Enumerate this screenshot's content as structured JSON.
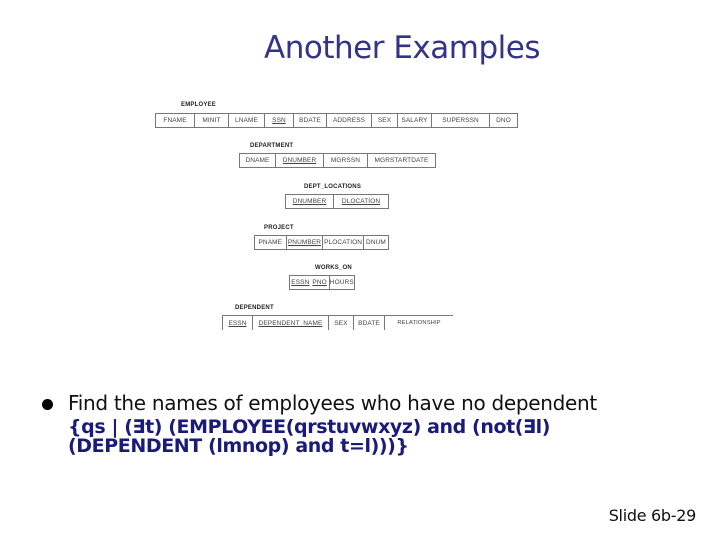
{
  "slide": {
    "title": "Another Examples",
    "slide_number": "Slide 6b-29"
  },
  "schema": {
    "employee": {
      "name": "EMPLOYEE",
      "attributes": [
        "FNAME",
        "MINIT",
        "LNAME",
        "SSN",
        "BDATE",
        "ADDRESS",
        "SEX",
        "SALARY",
        "SUPERSSN",
        "DNO"
      ],
      "key": [
        "SSN"
      ]
    },
    "department": {
      "name": "DEPARTMENT",
      "attributes": [
        "DNAME",
        "DNUMBER",
        "MGRSSN",
        "MGRSTARTDATE"
      ],
      "key": [
        "DNUMBER"
      ]
    },
    "dept_locations": {
      "name": "DEPT_LOCATIONS",
      "attributes": [
        "DNUMBER",
        "DLOCATION"
      ],
      "key": [
        "DNUMBER",
        "DLOCATION"
      ]
    },
    "project": {
      "name": "PROJECT",
      "attributes": [
        "PNAME",
        "PNUMBER",
        "PLOCATION",
        "DNUM"
      ],
      "key": [
        "PNUMBER"
      ]
    },
    "works_on": {
      "name": "WORKS_ON",
      "attributes": [
        "ESSN",
        "PNO",
        "HOURS"
      ],
      "key": [
        "ESSN",
        "PNO"
      ]
    },
    "dependent": {
      "name": "DEPENDENT",
      "attributes": [
        "ESSN",
        "DEPENDENT_NAME",
        "SEX",
        "BDATE",
        "RELATIONSHIP"
      ],
      "key": [
        "ESSN",
        "DEPENDENT_NAME"
      ]
    }
  },
  "body": {
    "bullet_text": "Find the names of employees who have no dependent",
    "formula_line1": "{qs | (∃t) (EMPLOYEE(qrstuvwxyz) and (not(∃l)",
    "formula_line2": "(DEPENDENT (lmnop) and t=l)))}"
  }
}
